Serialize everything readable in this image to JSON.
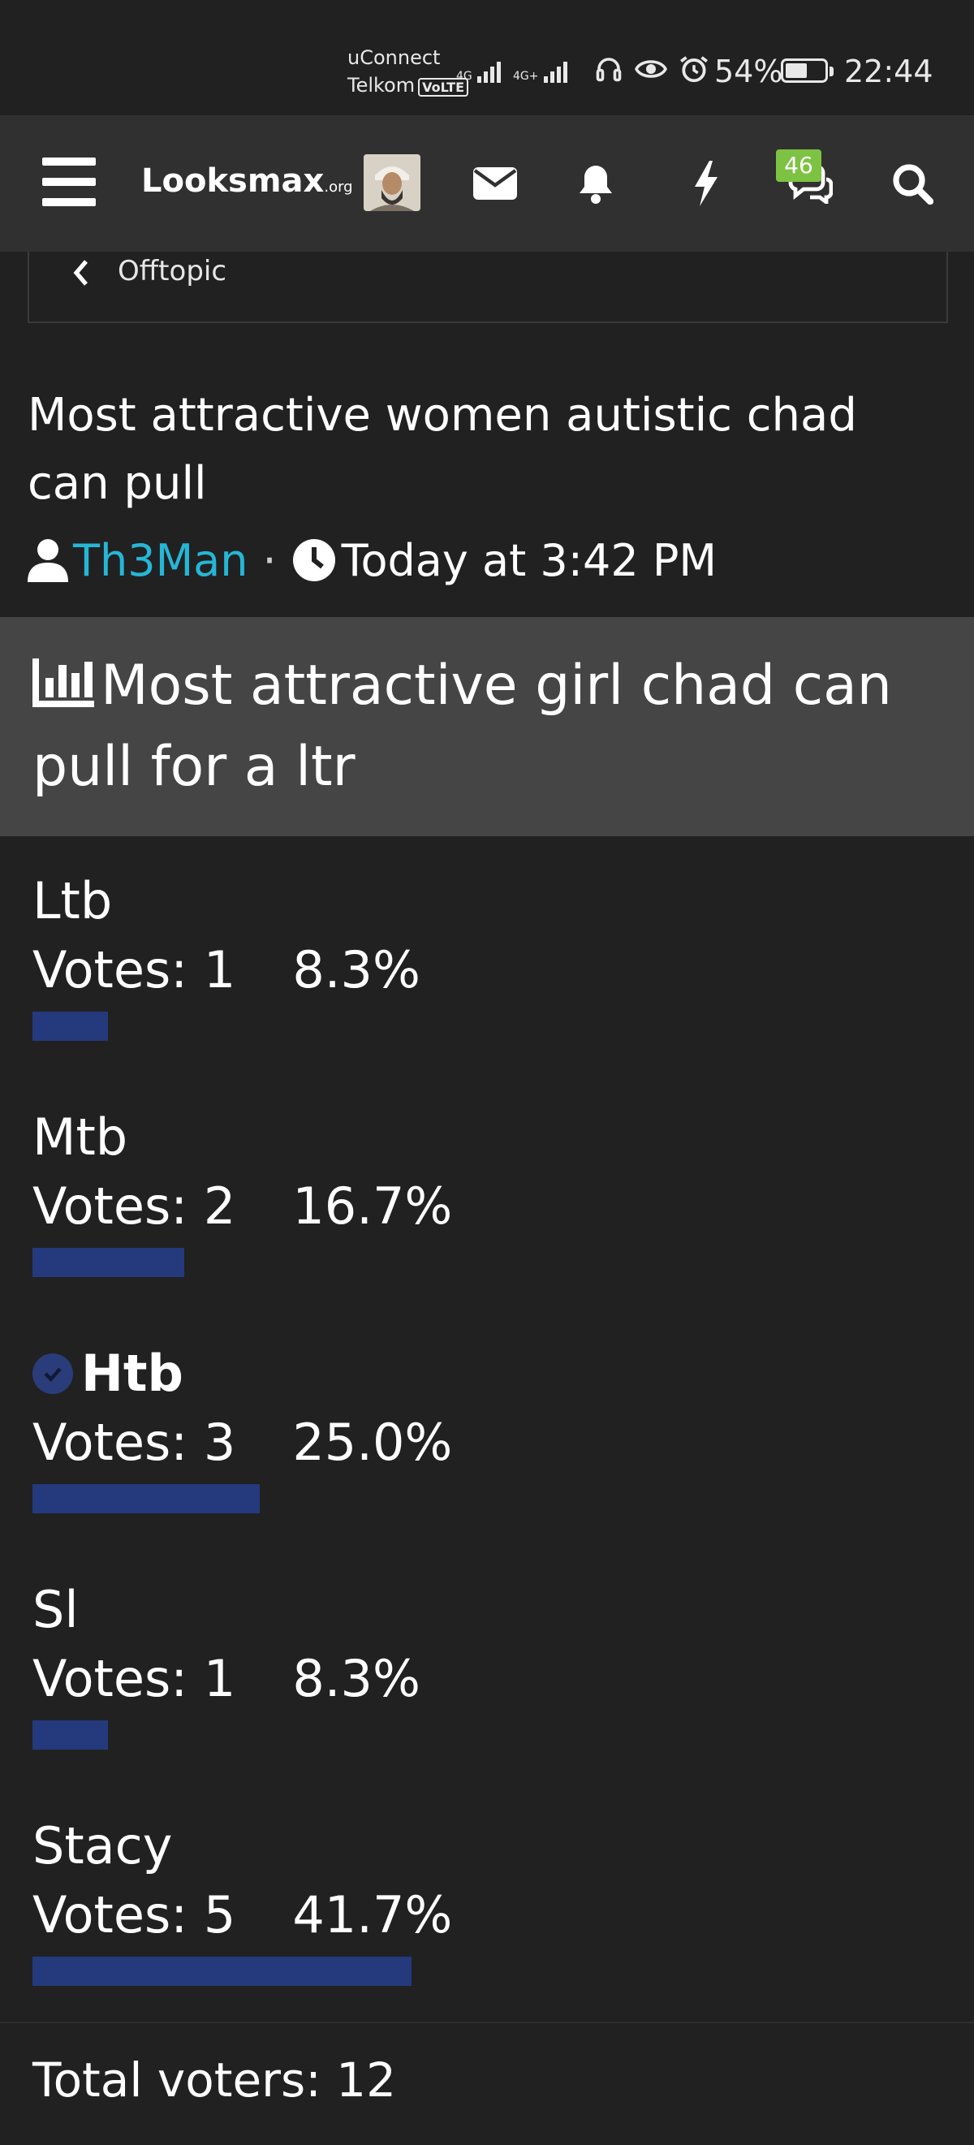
{
  "status_bar": {
    "carrier_line1": "uConnect",
    "carrier_line2": "Telkom",
    "volte": "VoLTE",
    "net1": "4G",
    "net2": "4G+",
    "battery": "54%",
    "time": "22:44"
  },
  "header": {
    "logo_main": "Looksmax",
    "logo_suffix": ".org",
    "badge_count": "46"
  },
  "breadcrumb": {
    "label": "Offtopic"
  },
  "thread": {
    "title": "Most attractive women autistic chad can pull",
    "author": "Th3Man",
    "time": "Today at 3:42 PM"
  },
  "poll": {
    "question": "Most attractive girl chad can pull for a ltr",
    "options": [
      {
        "label": "Ltb",
        "votes": "Votes: 1",
        "percent": "8.3%",
        "fraction": 0.083,
        "voted": false
      },
      {
        "label": "Mtb",
        "votes": "Votes: 2",
        "percent": "16.7%",
        "fraction": 0.167,
        "voted": false
      },
      {
        "label": "Htb",
        "votes": "Votes: 3",
        "percent": "25.0%",
        "fraction": 0.25,
        "voted": true
      },
      {
        "label": "Sl",
        "votes": "Votes: 1",
        "percent": "8.3%",
        "fraction": 0.083,
        "voted": false
      },
      {
        "label": "Stacy",
        "votes": "Votes: 5",
        "percent": "41.7%",
        "fraction": 0.417,
        "voted": false
      }
    ],
    "total": "Total voters: 12"
  },
  "colors": {
    "background": "#212121",
    "header": "#303030",
    "poll_header": "#454545",
    "bar": "#253a7c",
    "username": "#26b6d6",
    "badge": "#7dc242"
  }
}
